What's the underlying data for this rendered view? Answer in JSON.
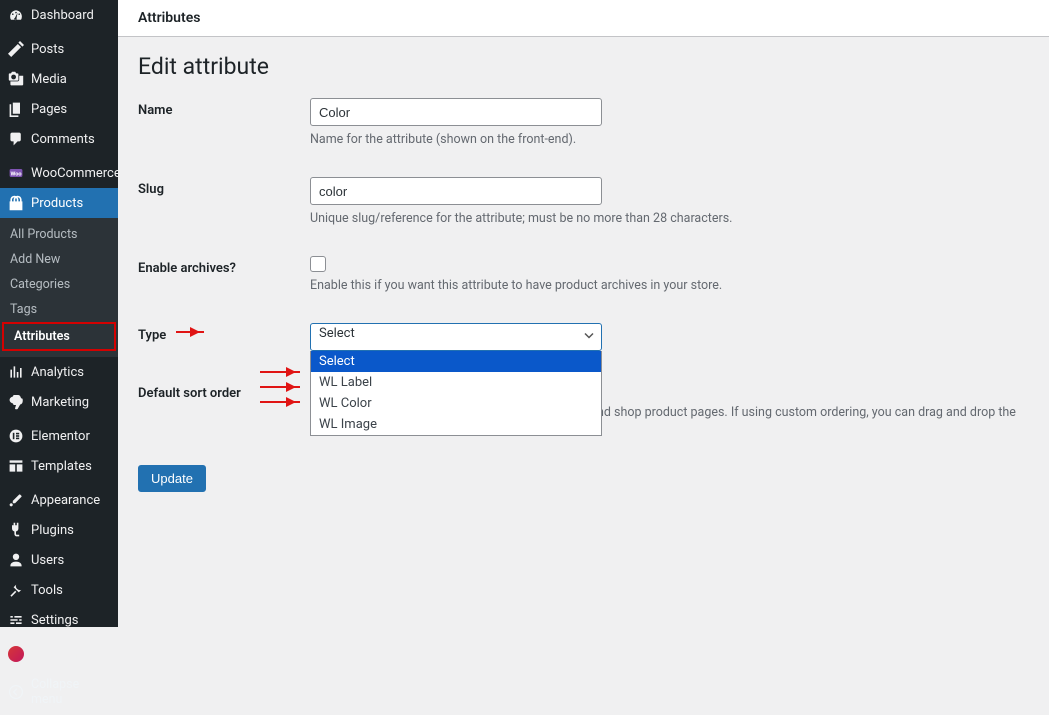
{
  "topbar": {
    "breadcrumb": "Attributes"
  },
  "page": {
    "title": "Edit attribute"
  },
  "sidebar": {
    "dashboard": "Dashboard",
    "posts": "Posts",
    "media": "Media",
    "pages": "Pages",
    "comments": "Comments",
    "woocommerce": "WooCommerce",
    "products": "Products",
    "submenu": {
      "all": "All Products",
      "addnew": "Add New",
      "categories": "Categories",
      "tags": "Tags",
      "attributes": "Attributes"
    },
    "analytics": "Analytics",
    "marketing": "Marketing",
    "elementor": "Elementor",
    "templates": "Templates",
    "appearance": "Appearance",
    "plugins": "Plugins",
    "users": "Users",
    "tools": "Tools",
    "settings": "Settings",
    "woolentor": "WooLentor",
    "collapse": "Collapse menu"
  },
  "form": {
    "name": {
      "label": "Name",
      "value": "Color",
      "help": "Name for the attribute (shown on the front-end)."
    },
    "slug": {
      "label": "Slug",
      "value": "color",
      "help": "Unique slug/reference for the attribute; must be no more than 28 characters."
    },
    "archives": {
      "label": "Enable archives?",
      "help": "Enable this if you want this attribute to have product archives in your store."
    },
    "type": {
      "label": "Type",
      "value": "Select",
      "options": {
        "select": "Select",
        "wllabel": "WL Label",
        "wlcolor": "WL Color",
        "wlimage": "WL Image"
      }
    },
    "sort": {
      "label": "Default sort order",
      "help": "Determines the sort order of the terms on the frontend shop product pages. If using custom ordering, you can drag and drop the terms in this attribute."
    },
    "update": "Update"
  }
}
